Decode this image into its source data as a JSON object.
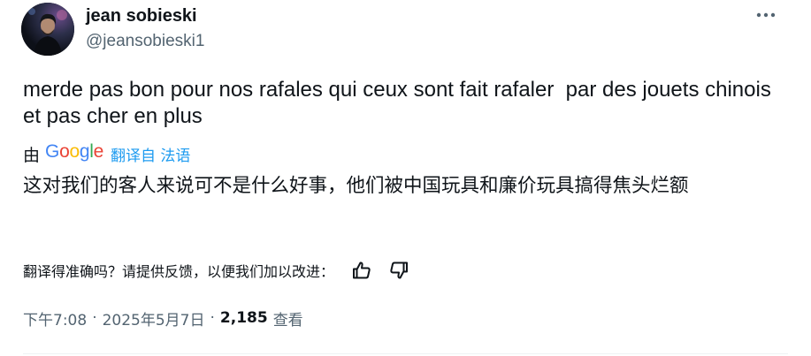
{
  "author": {
    "display_name": "jean sobieski",
    "handle": "@jeansobieski1"
  },
  "icons": {
    "more": "more-horizontal-icon",
    "thumb_up": "thumbs-up-icon",
    "thumb_down": "thumbs-down-icon"
  },
  "tweet": {
    "text": "merde pas bon pour nos rafales qui ceux sont fait rafaler  par des jouets chinois et pas cher en plus"
  },
  "translation": {
    "by_prefix": "由",
    "provider": "Google",
    "link_label": "翻译自 法语",
    "translated_text": "这对我们的客人来说可不是什么好事，他们被中国玩具和廉价玩具搞得焦头烂额"
  },
  "feedback": {
    "prompt": "翻译得准确吗？请提供反馈，以便我们加以改进："
  },
  "meta": {
    "time": "下午7:08",
    "separator": "·",
    "date": "2025年5月7日",
    "view_count": "2,185",
    "views_label": "查看"
  },
  "colors": {
    "text_primary": "#0f1419",
    "text_secondary": "#536471",
    "link": "#1d9bf0",
    "divider": "#eff3f4",
    "google_blue": "#4285F4",
    "google_red": "#EA4335",
    "google_yellow": "#FBBC05",
    "google_green": "#34A853"
  }
}
